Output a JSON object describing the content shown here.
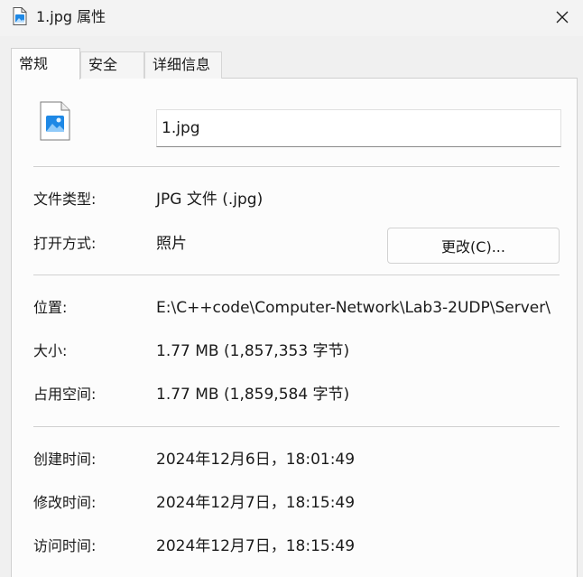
{
  "window": {
    "title": "1.jpg 属性"
  },
  "tabs": [
    {
      "label": "常规",
      "active": true
    },
    {
      "label": "安全",
      "active": false
    },
    {
      "label": "详细信息",
      "active": false
    }
  ],
  "general": {
    "file_name": "1.jpg",
    "file_type_label": "文件类型:",
    "file_type_value": "JPG 文件 (.jpg)",
    "opens_with_label": "打开方式:",
    "opens_with_value": "照片",
    "change_button": "更改(C)...",
    "location_label": "位置:",
    "location_value": "E:\\C++code\\Computer-Network\\Lab3-2UDP\\Server\\",
    "size_label": "大小:",
    "size_value": "1.77 MB (1,857,353 字节)",
    "size_on_disk_label": "占用空间:",
    "size_on_disk_value": "1.77 MB (1,859,584 字节)",
    "created_label": "创建时间:",
    "created_value": "2024年12月6日，18:01:49",
    "modified_label": "修改时间:",
    "modified_value": "2024年12月7日，18:15:49",
    "accessed_label": "访问时间:",
    "accessed_value": "2024年12月7日，18:15:49"
  },
  "icons": {
    "title": "image-file-icon",
    "file": "image-file-icon",
    "close": "close-icon"
  },
  "colors": {
    "accent": "#1e88e5",
    "window_bg": "#f0f0f0",
    "panel_bg": "#fcfcfc"
  }
}
